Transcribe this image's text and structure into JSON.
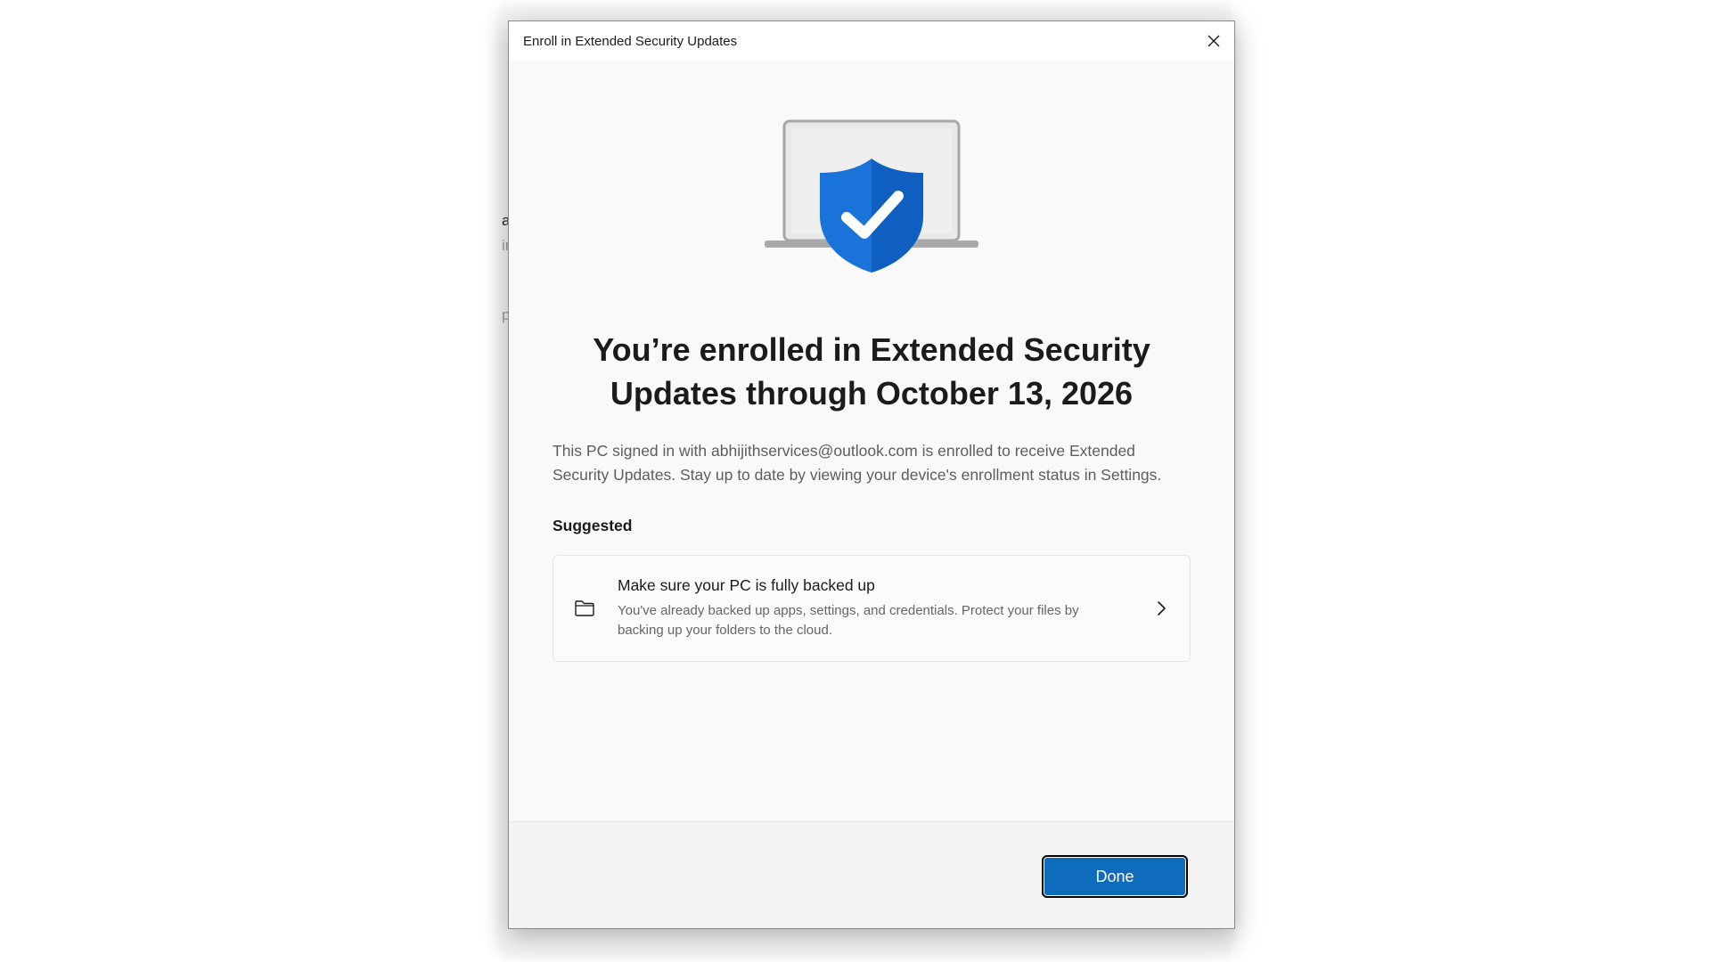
{
  "background": {
    "fragments": [
      "a",
      "ir",
      "p"
    ]
  },
  "dialog": {
    "title": "Enroll in Extended Security Updates",
    "close_icon": "close-icon",
    "hero_icon": "laptop-shield-check-icon",
    "headline": "You’re enrolled in Extended Security Updates through October 13, 2026",
    "description": "This PC signed in with abhijithservices@outlook.com is enrolled to receive Extended Security Updates. Stay up to date by viewing your device's enrollment status in Settings.",
    "suggested_label": "Suggested",
    "suggestion": {
      "icon": "folder-icon",
      "title": "Make sure your PC is fully backed up",
      "description": "You've already backed up apps, settings, and credentials. Protect your files by backing up your folders to the cloud.",
      "chevron": "chevron-right-icon"
    },
    "done_label": "Done"
  },
  "colors": {
    "accent": "#0f6cbd",
    "shield": "#1a73d9",
    "dialog_bg": "#f9f9f9",
    "footer_bg": "#f3f3f3"
  }
}
